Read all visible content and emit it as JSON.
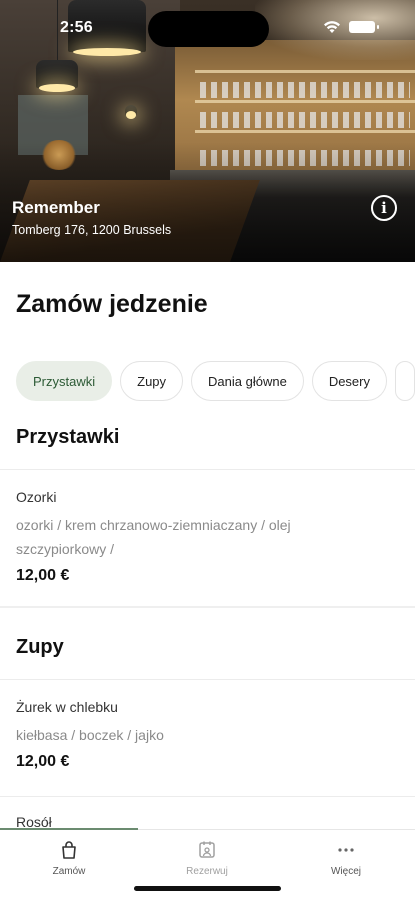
{
  "status_bar": {
    "time": "2:56"
  },
  "restaurant": {
    "name": "Remember",
    "address": "Tomberg 176, 1200 Brussels"
  },
  "page": {
    "title": "Zamów jedzenie"
  },
  "categories": [
    "Przystawki",
    "Zupy",
    "Dania główne",
    "Desery"
  ],
  "sections": [
    {
      "title": "Przystawki",
      "items": [
        {
          "name": "Ozorki",
          "desc_line1": "ozorki / krem chrzanowo-ziemniaczany / olej",
          "desc_line2": "szczypiorkowy /",
          "price": "12,00 €"
        }
      ]
    },
    {
      "title": "Zupy",
      "items": [
        {
          "name": "Żurek w chlebku",
          "desc_line1": "kiełbasa / boczek / jajko",
          "price": "12,00 €"
        },
        {
          "name": "Rosół"
        }
      ]
    }
  ],
  "bottom_nav": [
    {
      "label": "Zamów",
      "icon": "bag-icon"
    },
    {
      "label": "Rezerwuj",
      "icon": "reservation-icon"
    },
    {
      "label": "Więcej",
      "icon": "more-icon"
    }
  ],
  "colors": {
    "accent": "#2c5a35",
    "active_tab_bg": "#e9eee7"
  }
}
